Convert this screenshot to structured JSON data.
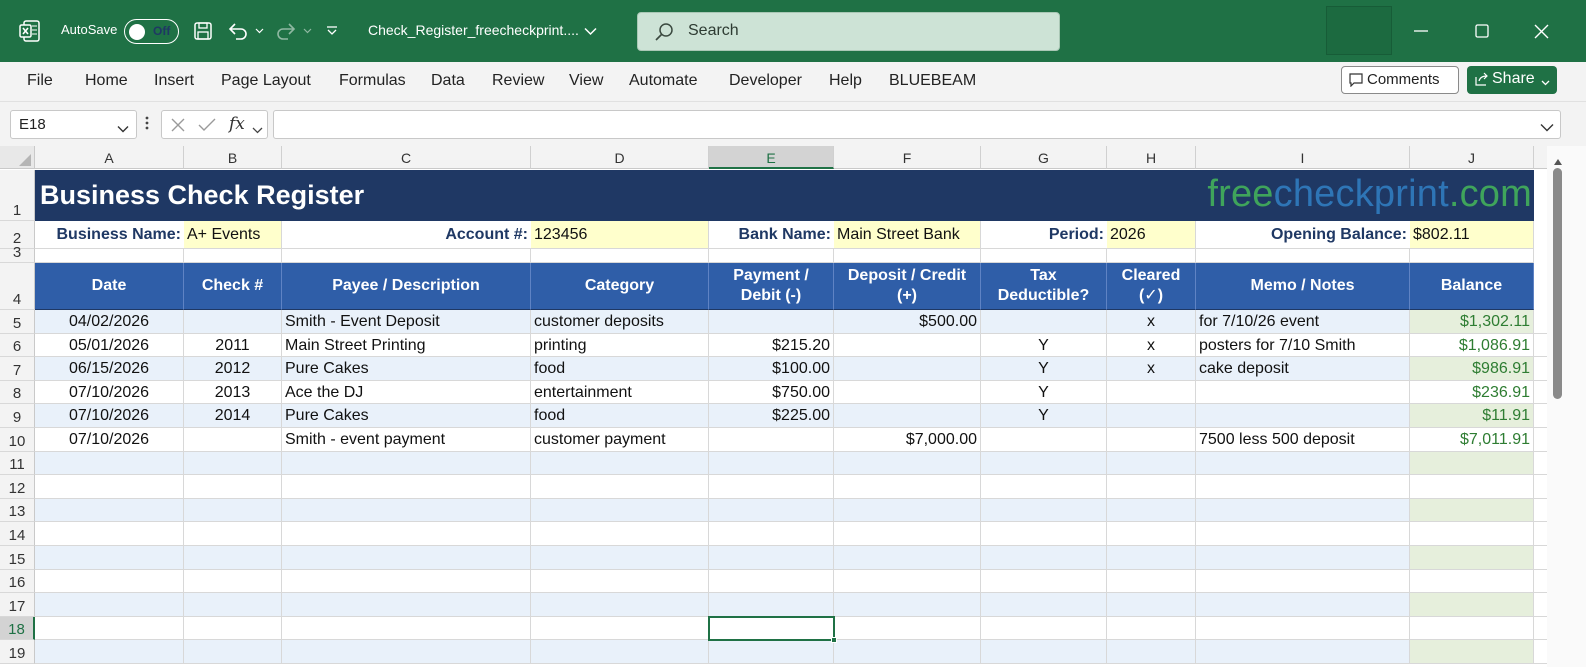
{
  "titlebar": {
    "autosave_label": "AutoSave",
    "autosave_state": "Off",
    "file_name": "Check_Register_freecheckprint....",
    "search_placeholder": "Search"
  },
  "ribbon": {
    "tabs": [
      "File",
      "Home",
      "Insert",
      "Page Layout",
      "Formulas",
      "Data",
      "Review",
      "View",
      "Automate",
      "Developer",
      "Help",
      "BLUEBEAM"
    ],
    "comments_label": "Comments",
    "share_label": "Share"
  },
  "formula_bar": {
    "name_box": "E18",
    "formula": "",
    "fx_label": "fx"
  },
  "columns": [
    "A",
    "B",
    "C",
    "D",
    "E",
    "F",
    "G",
    "H",
    "I",
    "J"
  ],
  "selected_column": "E",
  "rows": [
    "1",
    "2",
    "3",
    "4",
    "5",
    "6",
    "7",
    "8",
    "9",
    "10",
    "11",
    "12",
    "13",
    "14",
    "15",
    "16",
    "17",
    "18",
    "19"
  ],
  "selected_row": "18",
  "sheet": {
    "title": "Business Check Register",
    "logo": {
      "part1": "free",
      "part2": "checkprint",
      "part3": ".com"
    },
    "info": {
      "business_name_label": "Business Name:",
      "business_name": "A+ Events",
      "account_label": "Account #:",
      "account": "123456",
      "bank_label": "Bank Name:",
      "bank": "Main Street Bank",
      "period_label": "Period:",
      "period": "2026",
      "opening_label": "Opening Balance:",
      "opening": "$802.11"
    },
    "headers": [
      "Date",
      "Check #",
      "Payee / Description",
      "Category",
      "Payment / Debit (-)",
      "Deposit / Credit (+)",
      "Tax Deductible?",
      "Cleared (✓)",
      "Memo / Notes",
      "Balance"
    ],
    "transactions": [
      {
        "date": "04/02/2026",
        "check": "",
        "payee": "Smith - Event Deposit",
        "category": "customer deposits",
        "payment": "",
        "deposit": "$500.00",
        "tax": "",
        "cleared": "x",
        "memo": "for 7/10/26 event",
        "balance": "$1,302.11"
      },
      {
        "date": "05/01/2026",
        "check": "2011",
        "payee": "Main Street Printing",
        "category": "printing",
        "payment": "$215.20",
        "deposit": "",
        "tax": "Y",
        "cleared": "x",
        "memo": "posters for 7/10 Smith",
        "balance": "$1,086.91"
      },
      {
        "date": "06/15/2026",
        "check": "2012",
        "payee": "Pure Cakes",
        "category": "food",
        "payment": "$100.00",
        "deposit": "",
        "tax": "Y",
        "cleared": "x",
        "memo": "cake deposit",
        "balance": "$986.91"
      },
      {
        "date": "07/10/2026",
        "check": "2013",
        "payee": "Ace the DJ",
        "category": "entertainment",
        "payment": "$750.00",
        "deposit": "",
        "tax": "Y",
        "cleared": "",
        "memo": "",
        "balance": "$236.91"
      },
      {
        "date": "07/10/2026",
        "check": "2014",
        "payee": "Pure Cakes",
        "category": "food",
        "payment": "$225.00",
        "deposit": "",
        "tax": "Y",
        "cleared": "",
        "memo": "",
        "balance": "$11.91"
      },
      {
        "date": "07/10/2026",
        "check": "",
        "payee": "Smith - event payment",
        "category": "customer payment",
        "payment": "",
        "deposit": "$7,000.00",
        "tax": "",
        "cleared": "",
        "memo": "7500 less 500 deposit",
        "balance": "$7,011.91"
      }
    ]
  },
  "colors": {
    "excel_green": "#1f7145",
    "banner_navy": "#1f3864",
    "header_blue": "#2f5ea8",
    "input_yellow": "#ffffcc",
    "stripe_blue": "#e9f1fa",
    "balance_green_fill": "#e6efdc",
    "balance_text": "#2e7d32"
  }
}
